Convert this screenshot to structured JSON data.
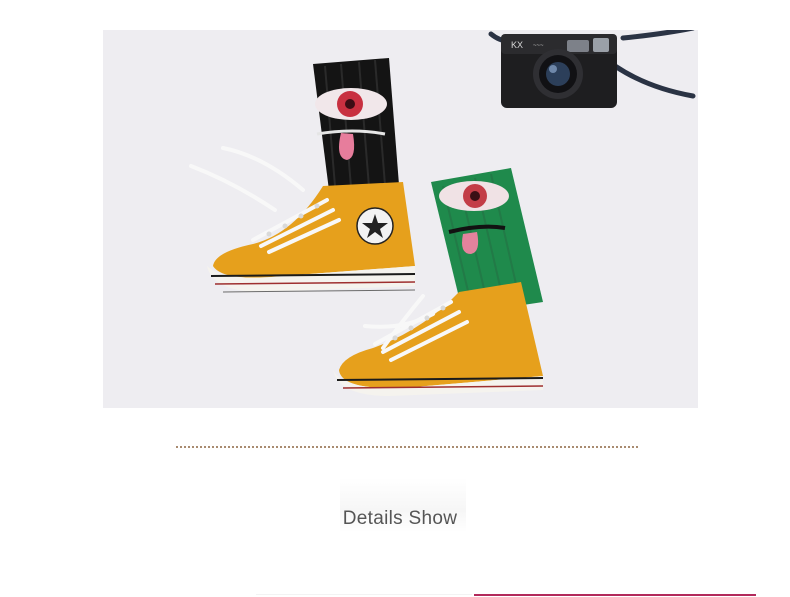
{
  "section": {
    "title": "Details Show",
    "accent_color": "#b2295b",
    "divider_color": "#a98b70"
  },
  "photo": {
    "camera_brand": "KX"
  }
}
